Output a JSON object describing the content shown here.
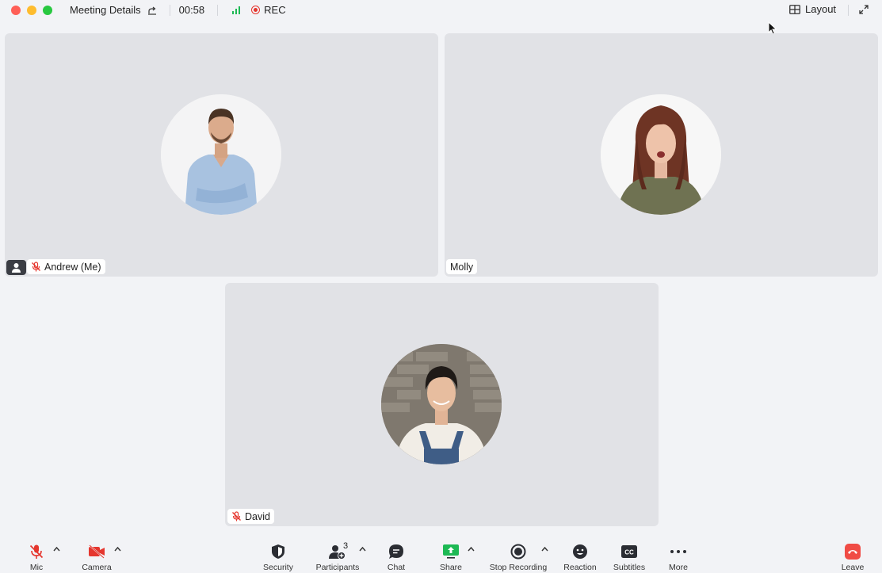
{
  "titlebar": {
    "meeting_title": "Meeting Details",
    "timer": "00:58",
    "rec_label": "REC",
    "layout_label": "Layout"
  },
  "participants": [
    {
      "name": "Andrew (Me)",
      "muted": true,
      "is_me": true
    },
    {
      "name": "Molly",
      "muted": false,
      "is_me": false
    },
    {
      "name": "David",
      "muted": true,
      "is_me": false
    }
  ],
  "toolbar": {
    "mic_label": "Mic",
    "camera_label": "Camera",
    "security_label": "Security",
    "participants_label": "Participants",
    "participants_count": "3",
    "chat_label": "Chat",
    "share_label": "Share",
    "stop_recording_label": "Stop Recording",
    "reaction_label": "Reaction",
    "subtitles_label": "Subtitles",
    "more_label": "More",
    "leave_label": "Leave"
  },
  "colors": {
    "background": "#f2f3f6",
    "tile": "#e1e2e6",
    "muted_red": "#e5362e",
    "share_green": "#1db954",
    "leave_red": "#f04b45"
  }
}
